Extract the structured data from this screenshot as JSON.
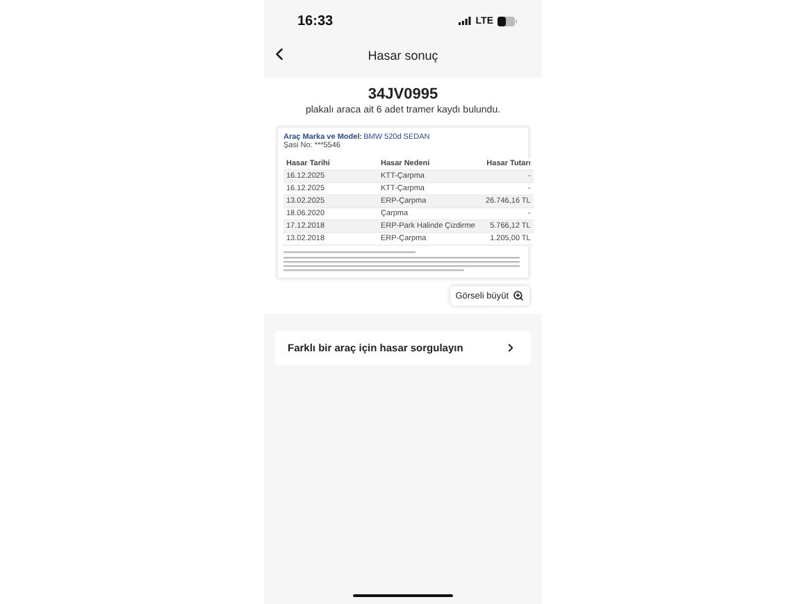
{
  "status_bar": {
    "time": "16:33",
    "network": "LTE"
  },
  "header": {
    "title": "Hasar sonuç"
  },
  "plate": "34JV0995",
  "summary": "plakalı araca ait 6 adet tramer kaydı bulundu.",
  "report": {
    "model_label": "Araç Marka ve Model:",
    "model_value": "BMW 520d SEDAN",
    "chassis": "Şasi No: ***5546",
    "columns": [
      "Hasar Tarihi",
      "Hasar Nedeni",
      "Hasar Tutarı"
    ],
    "rows": [
      {
        "date": "16.12.2025",
        "reason": "KTT-Çarpma",
        "amount": "-"
      },
      {
        "date": "16.12.2025",
        "reason": "KTT-Çarpma",
        "amount": "-"
      },
      {
        "date": "13.02.2025",
        "reason": "ERP-Çarpma",
        "amount": "26.746,16 TL"
      },
      {
        "date": "18.06.2020",
        "reason": "Çarpma",
        "amount": "-"
      },
      {
        "date": "17.12.2018",
        "reason": "ERP-Park Halinde Çizdirme",
        "amount": "5.766,12 TL"
      },
      {
        "date": "13.02.2018",
        "reason": "ERP-Çarpma",
        "amount": "1.205,00 TL"
      }
    ]
  },
  "enlarge_button": "Görseli büyüt",
  "query_card": "Farklı bir araç için hasar sorgulayın"
}
